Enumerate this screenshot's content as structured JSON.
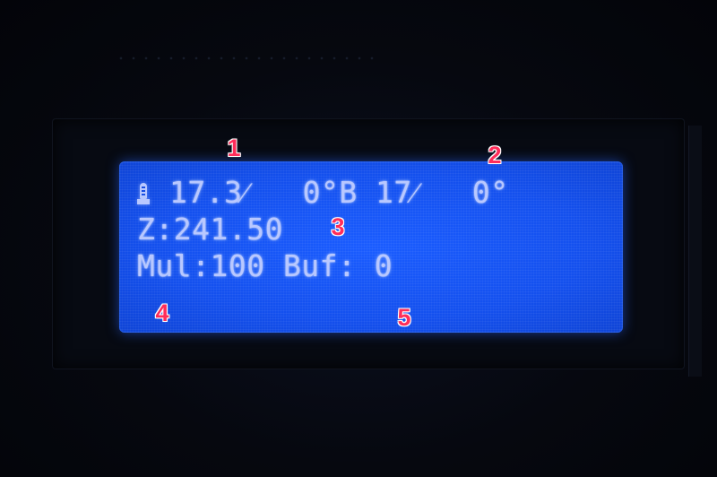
{
  "lcd": {
    "row1": {
      "icon": "hotend-icon",
      "text": "17.3⁄   0°B 17⁄   0°"
    },
    "row2": {
      "text": "Z:241.50"
    },
    "row3": {
      "text": "Mul:100 Buf: 0"
    },
    "row4": {
      "text": ""
    }
  },
  "annotations": {
    "labels": [
      "1",
      "2",
      "3",
      "4",
      "5"
    ]
  },
  "colors": {
    "lcd_background": "#1450ee",
    "lcd_text": "#b9c8ff",
    "annotation": "#ff2d5a",
    "device": "#06080f"
  }
}
